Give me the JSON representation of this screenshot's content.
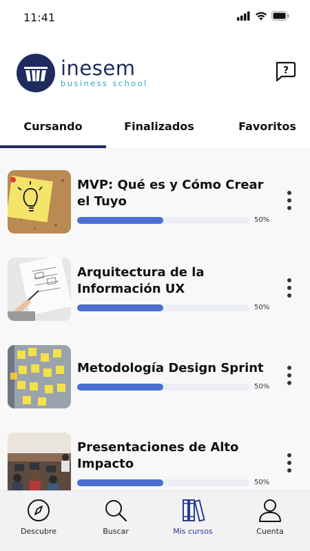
{
  "status": {
    "time": "11:41"
  },
  "brand": {
    "name": "inesem",
    "tagline": "business school"
  },
  "tabs": [
    {
      "label": "Cursando"
    },
    {
      "label": "Finalizados"
    },
    {
      "label": "Favoritos"
    }
  ],
  "active_tab": "Cursando",
  "courses": [
    {
      "title": "MVP: Qué es y Cómo Crear el Tuyo",
      "progress": 50,
      "progress_text": "50%"
    },
    {
      "title": "Arquitectura de la Información UX",
      "progress": 50,
      "progress_text": "50%"
    },
    {
      "title": "Metodología Design Sprint",
      "progress": 50,
      "progress_text": "50%"
    },
    {
      "title": "Presentaciones de Alto Impacto",
      "progress": 50,
      "progress_text": "50%"
    }
  ],
  "nav": [
    {
      "label": "Descubre",
      "icon": "compass-icon"
    },
    {
      "label": "Buscar",
      "icon": "search-icon"
    },
    {
      "label": "Mis cursos",
      "icon": "books-icon"
    },
    {
      "label": "Cuenta",
      "icon": "user-icon"
    }
  ],
  "colors": {
    "brand": "#1f2b5e",
    "accent": "#4a6fd0",
    "tagline": "#2fa4c8",
    "active_nav": "#2a3b8f"
  }
}
